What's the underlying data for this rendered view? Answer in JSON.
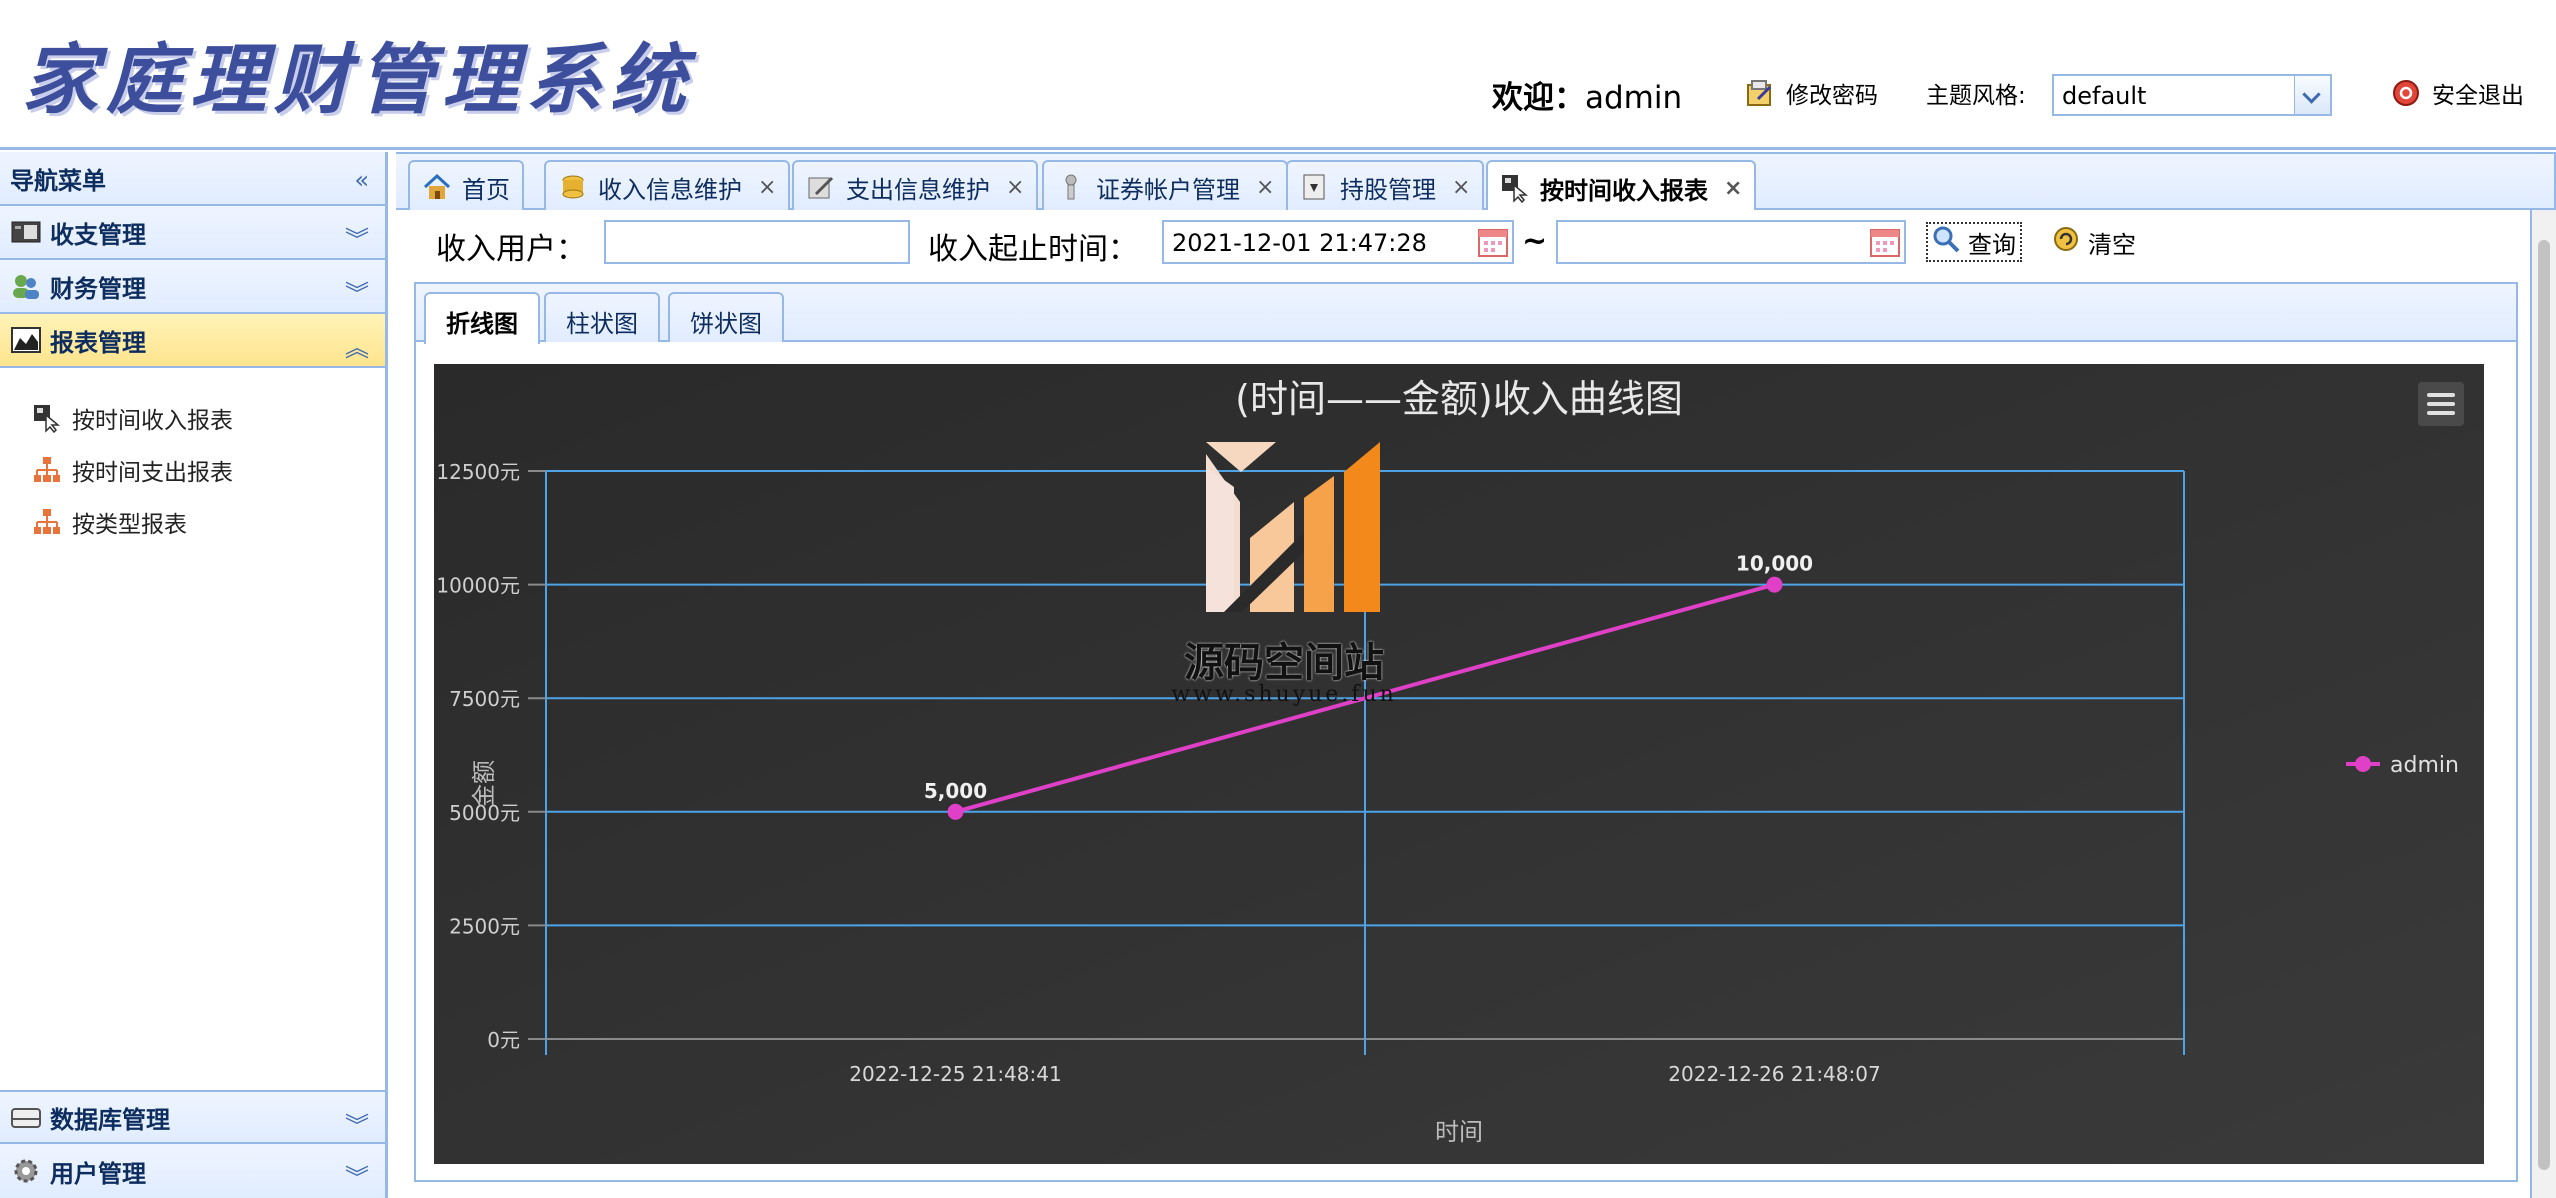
{
  "header": {
    "app_title": "家庭理财管理系统",
    "welcome_label": "欢迎：",
    "username": "admin",
    "change_password": "修改密码",
    "theme_label": "主题风格:",
    "theme_value": "default",
    "logout": "安全退出"
  },
  "sidebar": {
    "title": "导航菜单",
    "sections": [
      {
        "label": "收支管理"
      },
      {
        "label": "财务管理"
      },
      {
        "label": "报表管理"
      }
    ],
    "report_items": [
      {
        "label": "按时间收入报表"
      },
      {
        "label": "按时间支出报表"
      },
      {
        "label": "按类型报表"
      }
    ],
    "bottom_sections": [
      {
        "label": "数据库管理"
      },
      {
        "label": "用户管理"
      }
    ]
  },
  "tabs": [
    {
      "label": "首页"
    },
    {
      "label": "收入信息维护"
    },
    {
      "label": "支出信息维护"
    },
    {
      "label": "证券帐户管理"
    },
    {
      "label": "持股管理"
    },
    {
      "label": "按时间收入报表"
    }
  ],
  "filter": {
    "user_label": "收入用户：",
    "user_value": "",
    "time_label": "收入起止时间：",
    "start_time": "2021-12-01 21:47:28",
    "separator": "~",
    "end_time": "",
    "query": "查询",
    "clear": "清空"
  },
  "chart_tabs": [
    {
      "label": "折线图"
    },
    {
      "label": "柱状图"
    },
    {
      "label": "饼状图"
    }
  ],
  "watermark": {
    "text": "源码空间站",
    "url": "www.shuyue.fun"
  },
  "chart_data": {
    "type": "line",
    "title": "(时间——金额)收入曲线图",
    "xlabel": "时间",
    "ylabel": "金额",
    "categories": [
      "2022-12-25 21:48:41",
      "2022-12-26 21:48:07"
    ],
    "y_ticks": [
      "0元",
      "2500元",
      "5000元",
      "7500元",
      "10000元",
      "12500元"
    ],
    "ylim": [
      0,
      12500
    ],
    "grid": true,
    "legend_position": "right",
    "series": [
      {
        "name": "admin",
        "values": [
          5000,
          10000
        ],
        "labels": [
          "5,000",
          "10,000"
        ],
        "color": "#e040c8"
      }
    ],
    "background": "#2f2f2f",
    "grid_color": "#4da3e6"
  }
}
